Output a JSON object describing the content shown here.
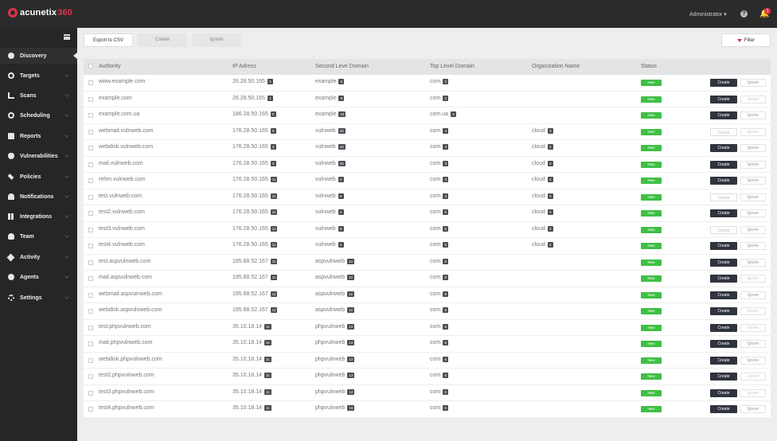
{
  "app": {
    "logo_text": "acunetix",
    "logo_num": "360",
    "user": "Administrator ▾",
    "help_icon": "?",
    "bell_icon": "bell-icon",
    "notification_count": "1"
  },
  "sidebar": {
    "items": [
      {
        "label": "Discovery",
        "icon": "discovery-icon"
      },
      {
        "label": "Targets",
        "icon": "target-icon"
      },
      {
        "label": "Scans",
        "icon": "scans-icon"
      },
      {
        "label": "Scheduling",
        "icon": "clock-icon"
      },
      {
        "label": "Reports",
        "icon": "report-icon"
      },
      {
        "label": "Vulnerabilities",
        "icon": "bug-icon"
      },
      {
        "label": "Policies",
        "icon": "edit-icon"
      },
      {
        "label": "Notifications",
        "icon": "bell-icon"
      },
      {
        "label": "Integrations",
        "icon": "grid-icon"
      },
      {
        "label": "Team",
        "icon": "team-icon"
      },
      {
        "label": "Activity",
        "icon": "activity-icon"
      },
      {
        "label": "Agents",
        "icon": "agent-icon"
      },
      {
        "label": "Settings",
        "icon": "gear-icon"
      }
    ]
  },
  "toolbar": {
    "export_label": "Export to CSV",
    "create_label": "Create",
    "ignore_label": "Ignore",
    "filter_label": "Filter"
  },
  "table": {
    "headers": {
      "authority": "Authority",
      "ip": "IP Adress",
      "sld": "Second Leve Domain",
      "tld": "Top Level Domain",
      "org": "Organization Name",
      "status": "Status"
    },
    "rows": [
      {
        "authority": "www.example.com",
        "ip": "26.28.50.165",
        "ip_n": "1",
        "sld": "example",
        "sld_n": "5",
        "tld": "com",
        "tld_n": "2",
        "org": "",
        "org_n": "",
        "status": "New",
        "create": "Create",
        "ignore": "Ignore",
        "create_enabled": true,
        "ignore_enabled": true
      },
      {
        "authority": "example.com",
        "ip": "26.28.50.165",
        "ip_n": "1",
        "sld": "example",
        "sld_n": "5",
        "tld": "com",
        "tld_n": "2",
        "org": "",
        "org_n": "",
        "status": "New",
        "create": "Create",
        "ignore": "Ignore",
        "create_enabled": true,
        "ignore_enabled": false
      },
      {
        "authority": "example.com.ua",
        "ip": "186.28.50.165",
        "ip_n": "5",
        "sld": "example",
        "sld_n": "44",
        "tld": "com.ua",
        "tld_n": "4",
        "org": "",
        "org_n": "",
        "status": "New",
        "create": "Create",
        "ignore": "Ignore",
        "create_enabled": true,
        "ignore_enabled": true
      },
      {
        "authority": "webmail.vulnweb.com",
        "ip": "176.28.50.165",
        "ip_n": "5",
        "sld": "vulnweb",
        "sld_n": "33",
        "tld": "com",
        "tld_n": "4",
        "org": "cloud",
        "org_n": "3",
        "status": "New",
        "create": "Create",
        "ignore": "Ignore",
        "create_enabled": false,
        "ignore_enabled": false
      },
      {
        "authority": "webdisk.vulnweb.com",
        "ip": "176.28.50.165",
        "ip_n": "4",
        "sld": "vulnweb",
        "sld_n": "44",
        "tld": "com",
        "tld_n": "4",
        "org": "cloud",
        "org_n": "4",
        "status": "New",
        "create": "Create",
        "ignore": "Ignore",
        "create_enabled": true,
        "ignore_enabled": true
      },
      {
        "authority": "mail.vulnweb.com",
        "ip": "176.28.50.165",
        "ip_n": "4",
        "sld": "vulnweb",
        "sld_n": "33",
        "tld": "com",
        "tld_n": "3",
        "org": "cloud",
        "org_n": "3",
        "status": "New",
        "create": "Create",
        "ignore": "Ignore",
        "create_enabled": true,
        "ignore_enabled": true
      },
      {
        "authority": "rehm.vulnweb.com",
        "ip": "176.28.50.165",
        "ip_n": "11",
        "sld": "vulnweb",
        "sld_n": "4",
        "tld": "com",
        "tld_n": "3",
        "org": "cloud",
        "org_n": "4",
        "status": "New",
        "create": "Create",
        "ignore": "Ignore",
        "create_enabled": true,
        "ignore_enabled": true
      },
      {
        "authority": "test.vulnweb.com",
        "ip": "176.28.50.165",
        "ip_n": "11",
        "sld": "vulnweb",
        "sld_n": "5",
        "tld": "com",
        "tld_n": "3",
        "org": "cloud",
        "org_n": "3",
        "status": "New",
        "create": "Create",
        "ignore": "Ignore",
        "create_enabled": false,
        "ignore_enabled": true
      },
      {
        "authority": "test2.vulnweb.com",
        "ip": "176.28.50.165",
        "ip_n": "11",
        "sld": "vulnweb",
        "sld_n": "4",
        "tld": "com",
        "tld_n": "5",
        "org": "cloud",
        "org_n": "4",
        "status": "New",
        "create": "Create",
        "ignore": "Ignore",
        "create_enabled": true,
        "ignore_enabled": true
      },
      {
        "authority": "test3.vulnweb.com",
        "ip": "176.28.50.165",
        "ip_n": "11",
        "sld": "vulnweb",
        "sld_n": "5",
        "tld": "com",
        "tld_n": "5",
        "org": "cloud",
        "org_n": "3",
        "status": "New",
        "create": "Create",
        "ignore": "Ignore",
        "create_enabled": false,
        "ignore_enabled": true
      },
      {
        "authority": "test4.vulnweb.com",
        "ip": "176.28.50.165",
        "ip_n": "11",
        "sld": "vulnweb",
        "sld_n": "4",
        "tld": "com",
        "tld_n": "5",
        "org": "cloud",
        "org_n": "4",
        "status": "New",
        "create": "Create",
        "ignore": "Ignore",
        "create_enabled": true,
        "ignore_enabled": true
      },
      {
        "authority": "test.aspvulnweb.com",
        "ip": "195.88.52.167",
        "ip_n": "11",
        "sld": "aspvulnweb",
        "sld_n": "12",
        "tld": "com",
        "tld_n": "5",
        "org": "",
        "org_n": "",
        "status": "New",
        "create": "Create",
        "ignore": "Ignore",
        "create_enabled": true,
        "ignore_enabled": true
      },
      {
        "authority": "mail.aspvulnweb.com",
        "ip": "195.88.52.167",
        "ip_n": "11",
        "sld": "aspvulnweb",
        "sld_n": "12",
        "tld": "com",
        "tld_n": "5",
        "org": "",
        "org_n": "",
        "status": "New",
        "create": "Create",
        "ignore": "Ignore",
        "create_enabled": true,
        "ignore_enabled": false
      },
      {
        "authority": "webmail.aspvulnweb.com",
        "ip": "195.88.52.167",
        "ip_n": "11",
        "sld": "aspvulnweb",
        "sld_n": "12",
        "tld": "com",
        "tld_n": "5",
        "org": "",
        "org_n": "",
        "status": "New",
        "create": "Create",
        "ignore": "Ignore",
        "create_enabled": true,
        "ignore_enabled": true
      },
      {
        "authority": "webdisk.aspvulnweb.com",
        "ip": "195.88.52.167",
        "ip_n": "11",
        "sld": "aspvulnweb",
        "sld_n": "12",
        "tld": "com",
        "tld_n": "5",
        "org": "",
        "org_n": "",
        "status": "New",
        "create": "Create",
        "ignore": "Ignore",
        "create_enabled": true,
        "ignore_enabled": false
      },
      {
        "authority": "test.phpvulnweb.com",
        "ip": "35.10.18.14",
        "ip_n": "11",
        "sld": "phpvulnweb",
        "sld_n": "12",
        "tld": "com",
        "tld_n": "5",
        "org": "",
        "org_n": "",
        "status": "New",
        "create": "Create",
        "ignore": "Ignore",
        "create_enabled": true,
        "ignore_enabled": false
      },
      {
        "authority": "mail.phpvulnweb.com",
        "ip": "35.10.18.14",
        "ip_n": "11",
        "sld": "phpvulnweb",
        "sld_n": "12",
        "tld": "com",
        "tld_n": "5",
        "org": "",
        "org_n": "",
        "status": "New",
        "create": "Create",
        "ignore": "Ignore",
        "create_enabled": true,
        "ignore_enabled": true
      },
      {
        "authority": "webdisk.phpvulnweb.com",
        "ip": "35.10.18.14",
        "ip_n": "11",
        "sld": "phpvulnweb",
        "sld_n": "12",
        "tld": "com",
        "tld_n": "5",
        "org": "",
        "org_n": "",
        "status": "New",
        "create": "Create",
        "ignore": "Ignore",
        "create_enabled": true,
        "ignore_enabled": true
      },
      {
        "authority": "test2.phpvulnweb.com",
        "ip": "35.10.18.14",
        "ip_n": "11",
        "sld": "phpvulnweb",
        "sld_n": "12",
        "tld": "com",
        "tld_n": "5",
        "org": "",
        "org_n": "",
        "status": "New",
        "create": "Create",
        "ignore": "Ignore",
        "create_enabled": true,
        "ignore_enabled": false
      },
      {
        "authority": "test3.phpvulnweb.com",
        "ip": "35.10.18.14",
        "ip_n": "11",
        "sld": "phpvulnweb",
        "sld_n": "12",
        "tld": "com",
        "tld_n": "5",
        "org": "",
        "org_n": "",
        "status": "New",
        "create": "Create",
        "ignore": "Ignore",
        "create_enabled": true,
        "ignore_enabled": false
      },
      {
        "authority": "test4.phpvulnweb.com",
        "ip": "35.10.18.14",
        "ip_n": "11",
        "sld": "phpvulnweb",
        "sld_n": "15",
        "tld": "com",
        "tld_n": "5",
        "org": "",
        "org_n": "",
        "status": "New",
        "create": "Create",
        "ignore": "Ignore",
        "create_enabled": true,
        "ignore_enabled": true
      }
    ]
  },
  "colors": {
    "accent": "#e2304b",
    "status_new": "#3fbf45",
    "topbar": "#2b2b2b",
    "sidebar": "#262626",
    "create_button": "#30343e"
  }
}
